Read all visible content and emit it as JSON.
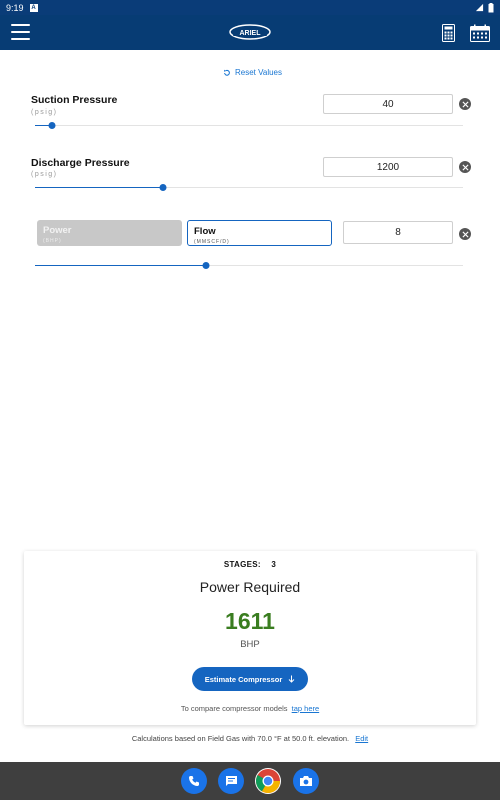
{
  "status_bar": {
    "time": "9:19",
    "notification_badge": "A"
  },
  "app_bar": {
    "logo_text": "ARIEL",
    "menu_icon": "hamburger-menu-icon",
    "calculator_icon": "calculator-icon",
    "calendar_icon": "calendar-icon"
  },
  "reset": {
    "label": "Reset Values"
  },
  "fields": {
    "suction": {
      "label": "Suction Pressure",
      "unit": "(psig)",
      "value": "40",
      "slider_fraction": 0.04
    },
    "discharge": {
      "label": "Discharge Pressure",
      "unit": "(psig)",
      "value": "1200",
      "slider_fraction": 0.3
    },
    "mode": {
      "power": {
        "label": "Power",
        "unit": "(BHP)"
      },
      "flow": {
        "label": "Flow",
        "unit": "(MMSCF/D)"
      },
      "selected": "flow",
      "value": "8",
      "slider_fraction": 0.4
    }
  },
  "result": {
    "stages_label": "STAGES:",
    "stages_value": "3",
    "title": "Power Required",
    "value": "1611",
    "unit": "BHP",
    "estimate_button": "Estimate Compressor",
    "compare_text": "To compare compressor models",
    "compare_link": "tap here"
  },
  "footer_note": {
    "text": "Calculations based on Field Gas with 70.0 °F at 50.0 ft. elevation.",
    "edit_link": "Edit"
  },
  "colors": {
    "app_bar": "#073c74",
    "accent": "#1565c0",
    "result_value": "#3a7d20"
  }
}
